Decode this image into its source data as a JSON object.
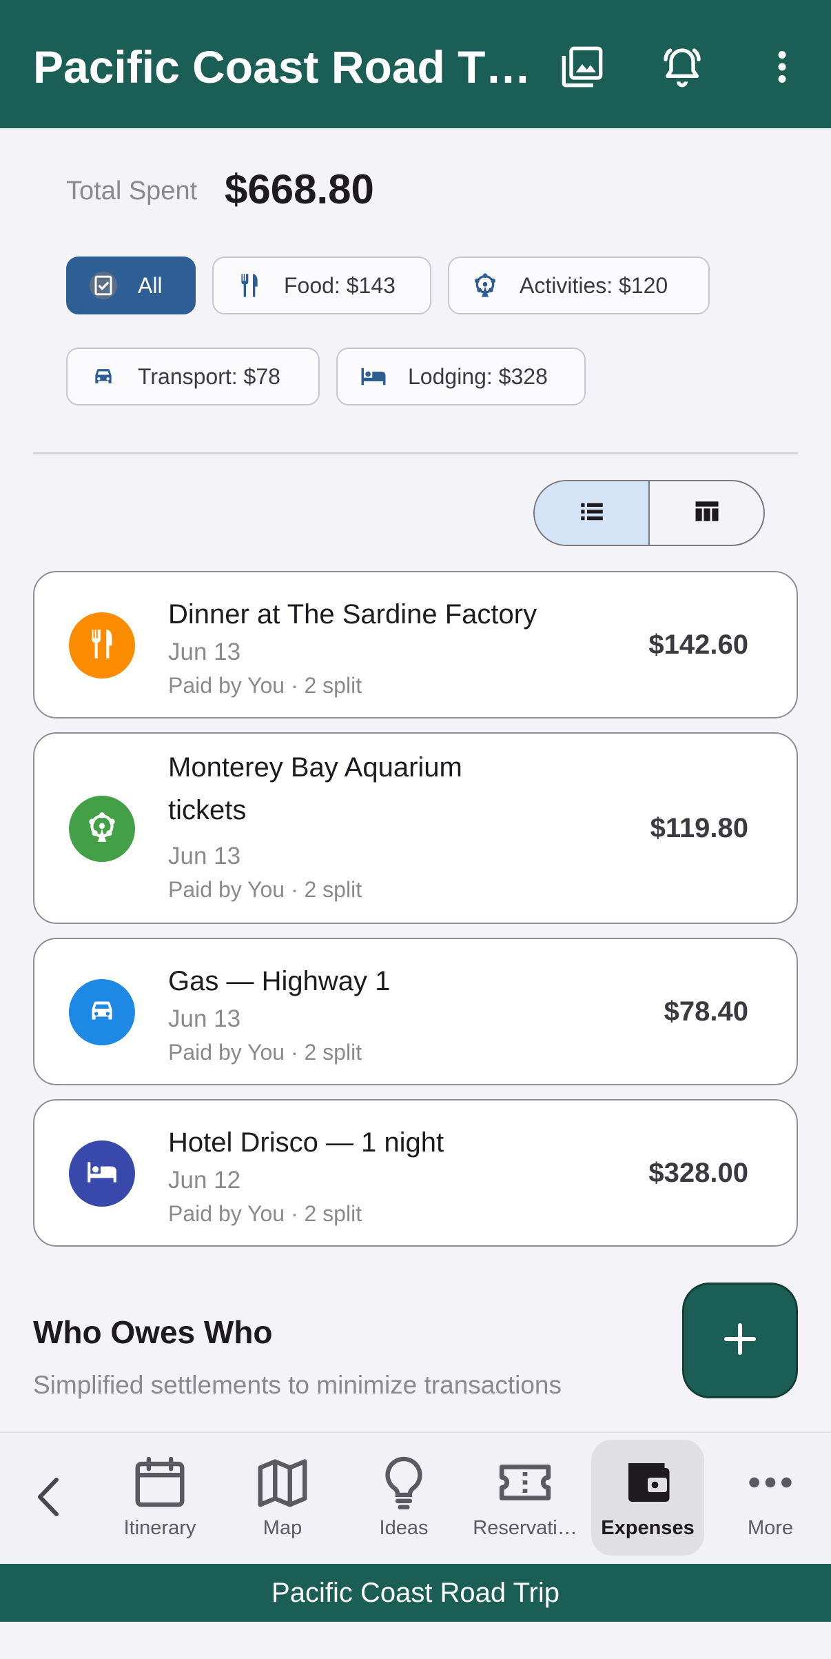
{
  "appbar": {
    "title": "Pacific Coast Road T…"
  },
  "summary": {
    "total_label": "Total Spent",
    "total_value": "$668.80"
  },
  "filters": [
    {
      "label": "All",
      "icon": "checklist-icon",
      "selected": true
    },
    {
      "label": "Food: $143",
      "icon": "fork-knife-icon",
      "selected": false
    },
    {
      "label": "Activities: $120",
      "icon": "ferris-wheel-icon",
      "selected": false
    },
    {
      "label": "Transport: $78",
      "icon": "car-icon",
      "selected": false
    },
    {
      "label": "Lodging: $328",
      "icon": "bed-icon",
      "selected": false
    }
  ],
  "view_toggle": {
    "selected": "list"
  },
  "expenses": [
    {
      "title": "Dinner at The Sardine Factory",
      "date": "Jun 13",
      "paid": "Paid by You · 2 split",
      "amount": "$142.60",
      "icon": "fork-knife-icon",
      "color": "#fb8c00"
    },
    {
      "title_line1": "Monterey Bay Aquarium",
      "title_line2": "tickets",
      "date": "Jun 13",
      "paid": "Paid by You · 2 split",
      "amount": "$119.80",
      "icon": "ferris-wheel-icon",
      "color": "#43a047"
    },
    {
      "title": "Gas — Highway 1",
      "date": "Jun 13",
      "paid": "Paid by You · 2 split",
      "amount": "$78.40",
      "icon": "car-icon",
      "color": "#1e88e5"
    },
    {
      "title": "Hotel Drisco — 1 night",
      "date": "Jun 12",
      "paid": "Paid by You · 2 split",
      "amount": "$328.00",
      "icon": "bed-icon",
      "color": "#3949ab"
    }
  ],
  "owes": {
    "title": "Who Owes Who",
    "subtitle": "Simplified settlements to minimize transactions"
  },
  "nav": [
    {
      "label": "Itinerary",
      "icon": "calendar-icon"
    },
    {
      "label": "Map",
      "icon": "map-icon"
    },
    {
      "label": "Ideas",
      "icon": "lightbulb-icon"
    },
    {
      "label": "Reservati…",
      "icon": "ticket-icon"
    },
    {
      "label": "Expenses",
      "icon": "wallet-icon",
      "active": true
    },
    {
      "label": "More",
      "icon": "more-horizontal-icon"
    }
  ],
  "footer": {
    "title": "Pacific Coast Road Trip"
  },
  "colors": {
    "primary": "#1b5e55",
    "chip_selected": "#2e5f94",
    "toggle_selected": "#d4e3f6"
  }
}
